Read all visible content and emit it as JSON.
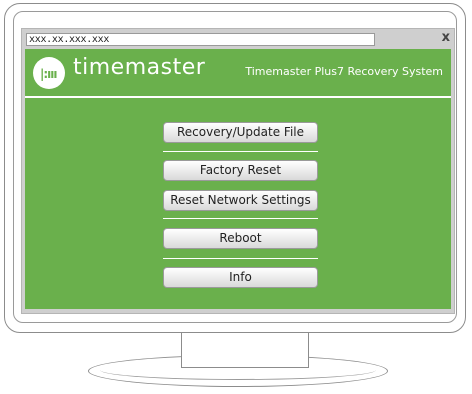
{
  "browser": {
    "address": "xxx.xx.xxx.xxx",
    "close_label": "x"
  },
  "app": {
    "brand": "timemaster",
    "logo_glyph": "|:ııı",
    "title": "Timemaster Plus7 Recovery System",
    "accent_color": "#6ab04c"
  },
  "menu": {
    "recovery": "Recovery/Update File",
    "factory_reset": "Factory Reset",
    "reset_network": "Reset Network Settings",
    "reboot": "Reboot",
    "info": "Info"
  }
}
